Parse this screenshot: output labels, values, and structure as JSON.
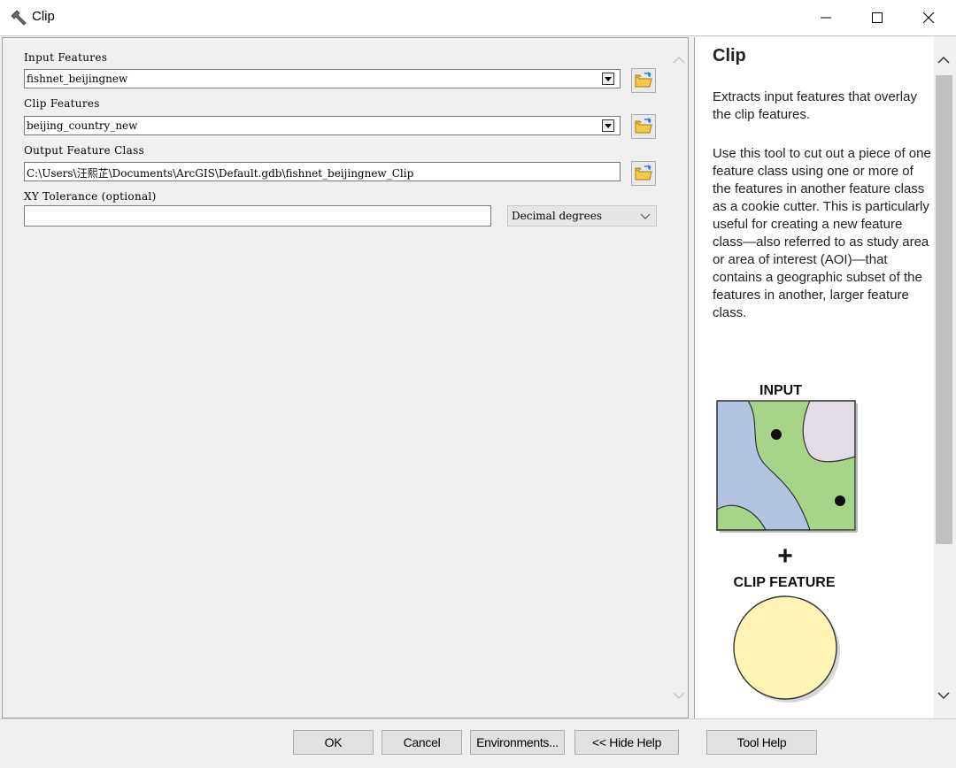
{
  "window": {
    "title": "Clip",
    "icon": "hammer-icon",
    "controls": [
      "minimize-icon",
      "maximize-icon",
      "close-icon"
    ]
  },
  "form": {
    "input_features": {
      "label": "Input Features",
      "value": "fishnet_beijingnew"
    },
    "clip_features": {
      "label": "Clip Features",
      "value": "beijing_country_new"
    },
    "output_feature_class": {
      "label": "Output Feature Class",
      "value": "C:\\Users\\汪熙芷\\Documents\\ArcGIS\\Default.gdb\\fishnet_beijingnew_Clip"
    },
    "xy_tolerance": {
      "label": "XY Tolerance (optional)",
      "value": "",
      "unit": "Decimal degrees"
    }
  },
  "help": {
    "title": "Clip",
    "summary": "Extracts input features that overlay the clip features.",
    "body": "Use this tool to cut out a piece of one feature class using one or more of the features in another feature class as a cookie cutter. This is particularly useful for creating a new feature class—also referred to as study area or area of interest (AOI)—that contains a geographic subset of the features in another, larger feature class.",
    "diagram": {
      "input_label": "INPUT",
      "plus": "+",
      "clip_label": "CLIP FEATURE",
      "minus": "-",
      "colors": {
        "green": "#a6d58a",
        "blue": "#b4c3e1",
        "lavender": "#e3dbe5",
        "clip_yellow": "#fff4b3"
      }
    }
  },
  "buttons": {
    "ok": "OK",
    "cancel": "Cancel",
    "environments": "Environments...",
    "hide_help": "<< Hide Help",
    "tool_help": "Tool Help"
  }
}
